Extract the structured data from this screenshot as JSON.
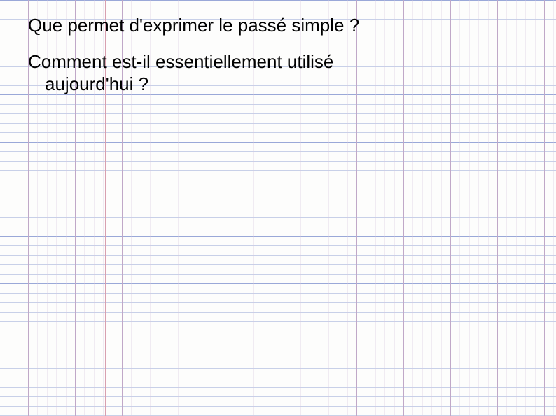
{
  "question1": "Que permet d'exprimer le passé simple ?",
  "question2_line1": "Comment est-il essentiellement utilisé",
  "question2_line2": "aujourd'hui ?"
}
